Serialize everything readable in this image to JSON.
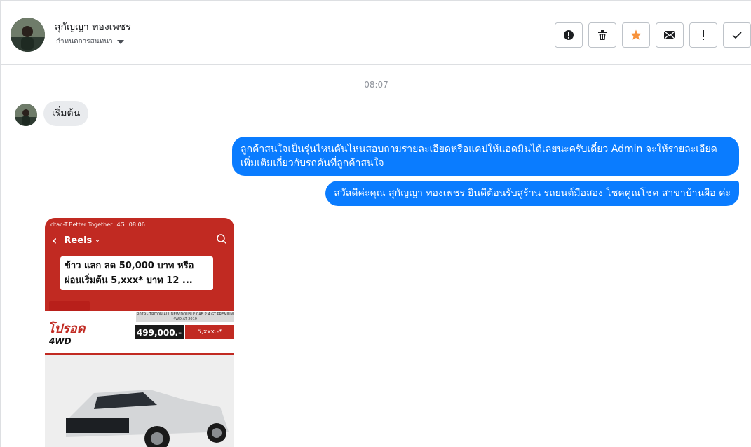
{
  "header": {
    "name": "สุกัญญา ทองเพชร",
    "subtitle": "กำหนดการสนทนา",
    "actions": [
      {
        "name": "report-button",
        "icon": "exclamation-circle-icon"
      },
      {
        "name": "delete-button",
        "icon": "trash-icon"
      },
      {
        "name": "star-button",
        "icon": "star-icon"
      },
      {
        "name": "mark-unread-button",
        "icon": "envelope-icon"
      },
      {
        "name": "flag-button",
        "icon": "exclamation-icon"
      },
      {
        "name": "done-button",
        "icon": "check-icon"
      }
    ]
  },
  "conversation": {
    "time": "08:07",
    "incoming_text": "เริ่มต้น",
    "outgoing": [
      "ลูกค้าสนใจเป็นรุ่นไหนคันไหนสอบถามรายละเอียดหรือแคปให้แอดมินได้เลยนะครับเดี๋ยว Admin จะให้รายละเอียดเพิ่มเติมเกี่ยวกับรถคันที่ลูกค้าสนใจ",
      "สวัสดีค่ะคุณ สุกัญญา ทองเพชร ยินดีต้อนรับสู่ร้าน รถยนต์มือสอง โชคคูณโชค สาขาบ้านผือ ค่ะ"
    ]
  },
  "attachment": {
    "status_carrier": "dtac-T.Better Together",
    "status_network": "4G",
    "status_time": "08:06",
    "reels_label": "Reels",
    "promo_text": "ข้าว แลก ลด 50,000 บาท หรือ ผ่อนเริ่มต้น 5,xxx* บาท 12 ...",
    "poster_model": "R079 - TRITON ALL NEW DOUBLE CAB 2.4 GT PREMIUM 4WD AT 2019",
    "poster_brand": "โปรอด",
    "poster_4wd": "4WD",
    "poster_price": "499,000.-",
    "poster_installment": "5,xxx.-*"
  },
  "colors": {
    "accent": "#0a7cff",
    "star": "#f7923b",
    "incoming_bg": "#e9ebee"
  }
}
